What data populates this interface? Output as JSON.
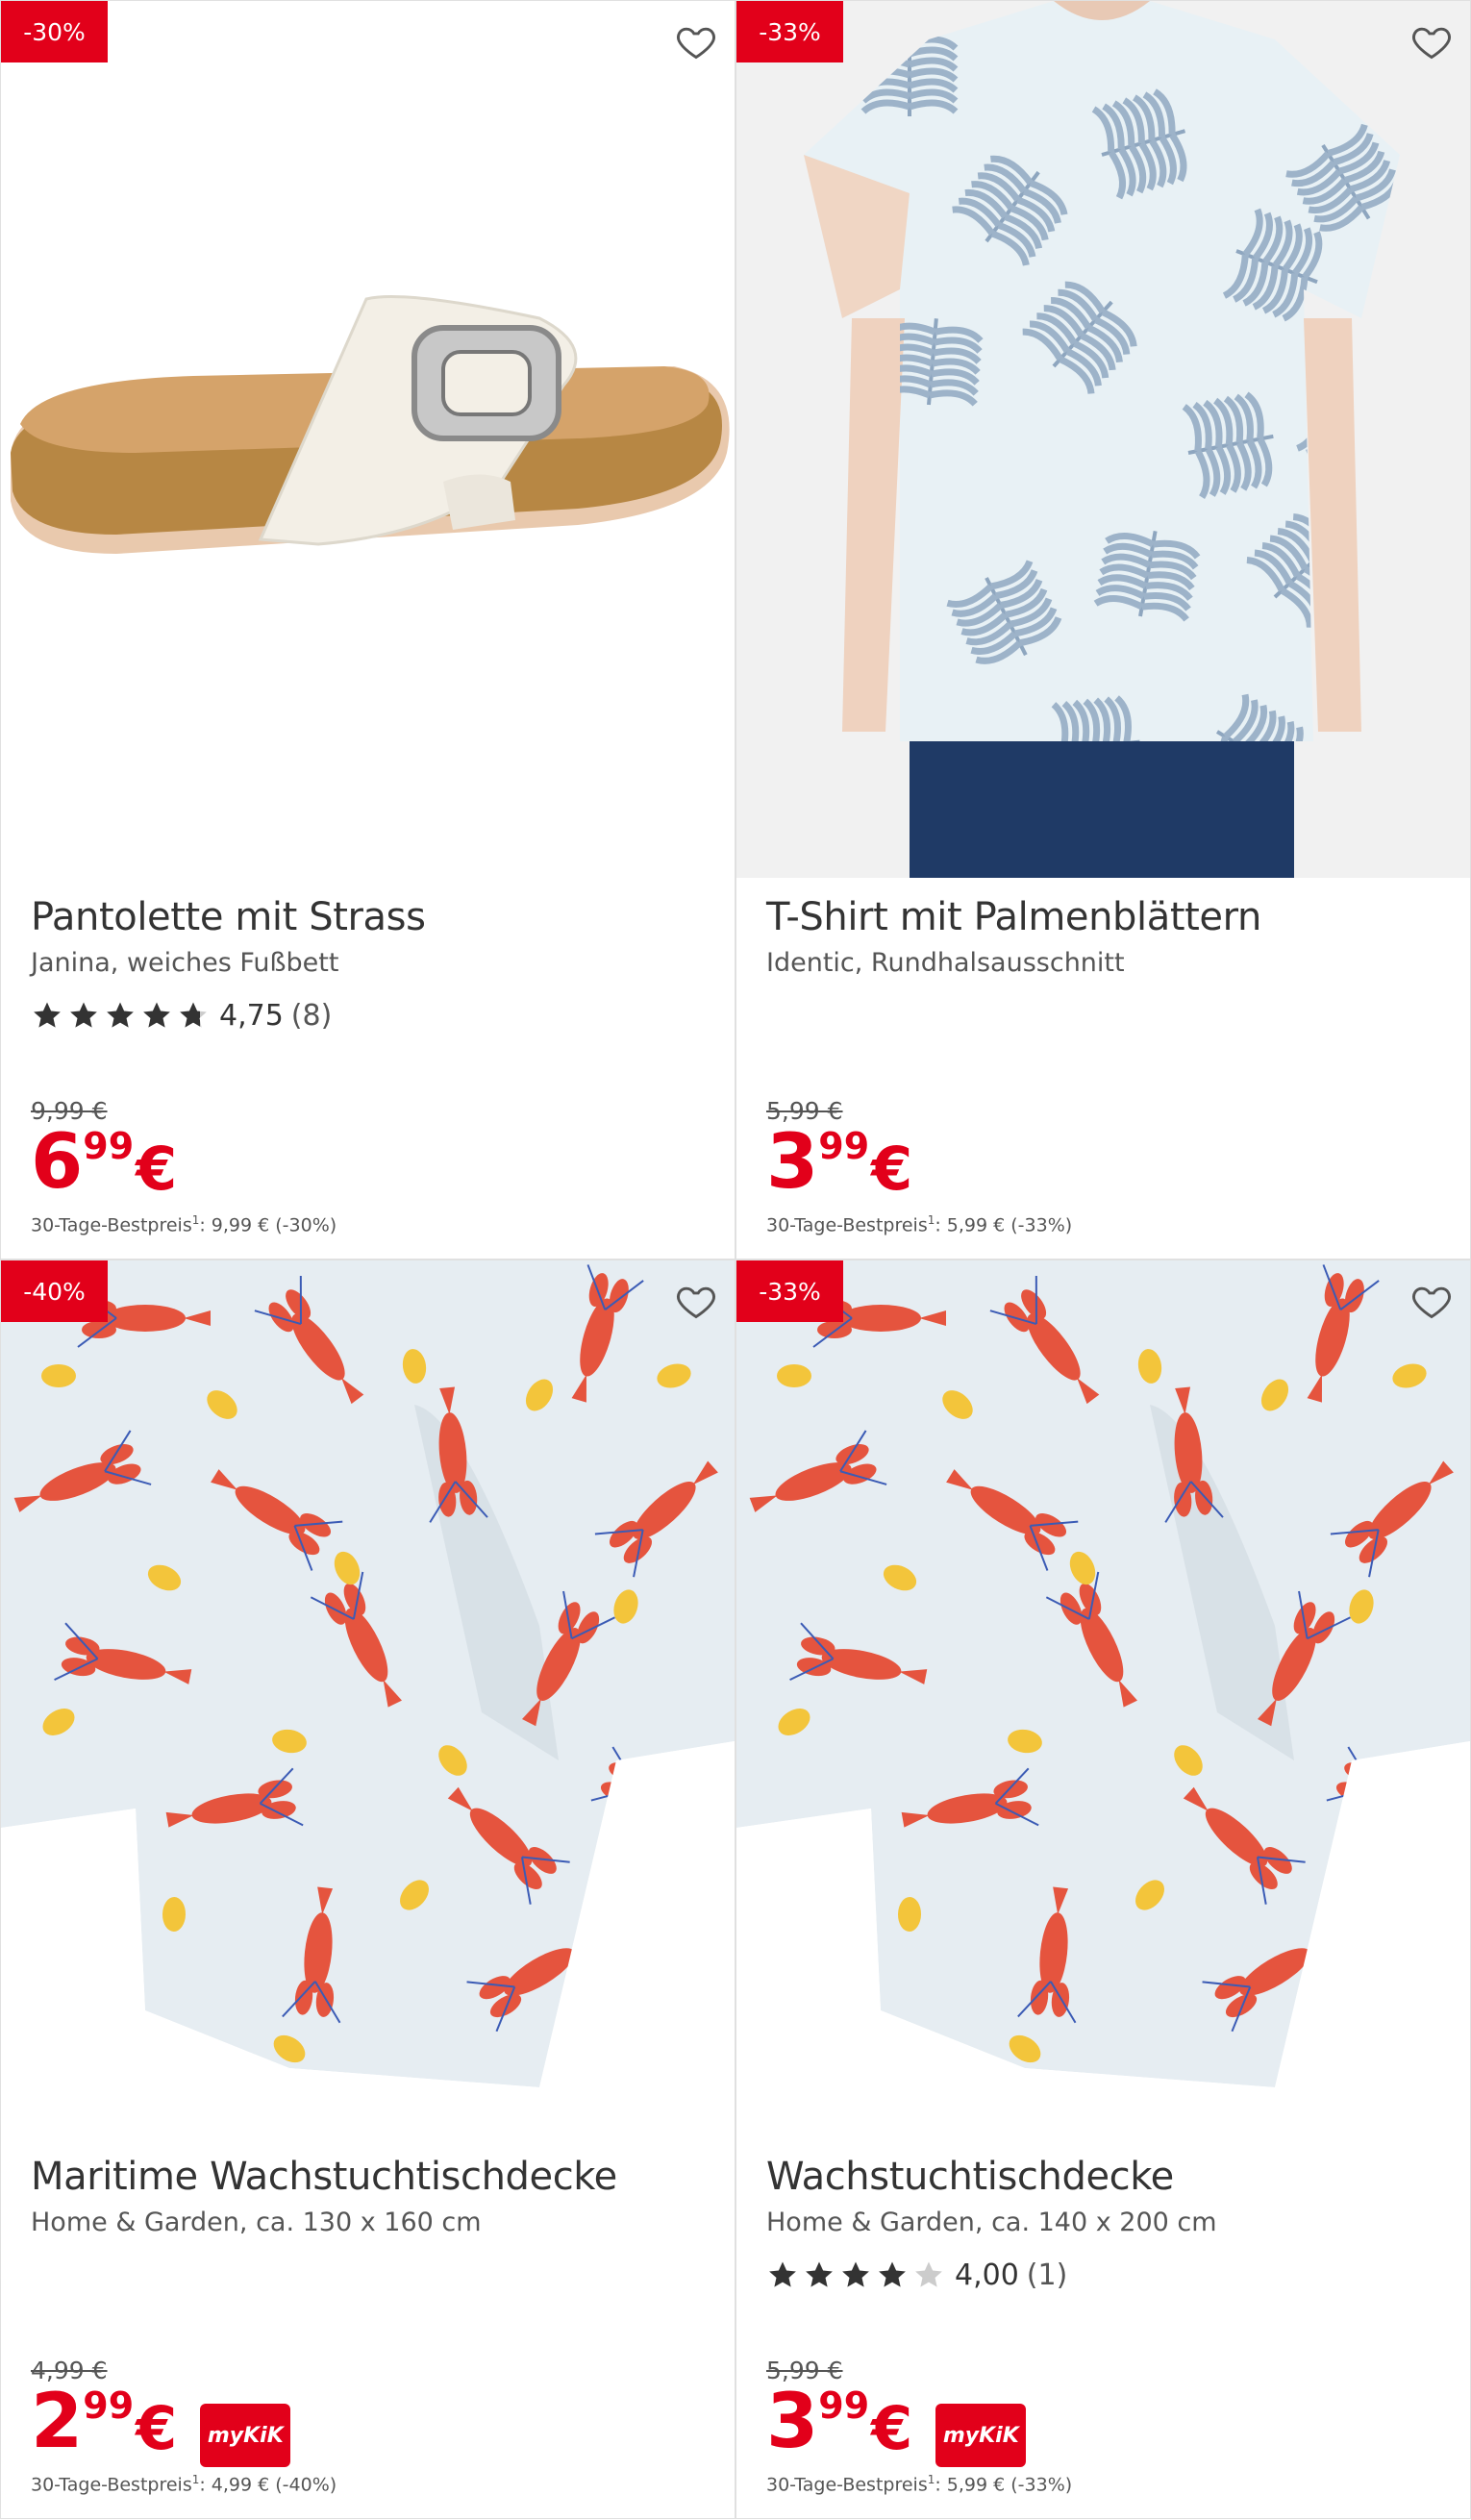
{
  "colors": {
    "accent": "#e2001a",
    "star_filled": "#333333",
    "star_empty": "#cccccc"
  },
  "products": [
    {
      "discount": "-30%",
      "title": "Pantolette mit Strass",
      "subtitle": "Janina, weiches Fußbett",
      "rating": {
        "stars": 4.75,
        "value": "4,75",
        "count": "(8)"
      },
      "old_price": "9,99 €",
      "price_int": "6",
      "price_dec": "99",
      "currency": "€",
      "mykik": "",
      "best_price_label": "30-Tage-Bestpreis",
      "best_price_sup": "1",
      "best_price_value": ": 9,99 € (-30%)",
      "image": "sandal"
    },
    {
      "discount": "-33%",
      "title": "T-Shirt mit Palmenblättern",
      "subtitle": "Identic, Rundhalsausschnitt",
      "rating": null,
      "old_price": "5,99 €",
      "price_int": "3",
      "price_dec": "99",
      "currency": "€",
      "mykik": "",
      "best_price_label": "30-Tage-Bestpreis",
      "best_price_sup": "1",
      "best_price_value": ": 5,99 € (-33%)",
      "image": "tshirt"
    },
    {
      "discount": "-40%",
      "title": "Maritime Wachstuchtischdecke",
      "subtitle": "Home & Garden, ca. 130 x 160 cm",
      "rating": null,
      "old_price": "4,99 €",
      "price_int": "2",
      "price_dec": "99",
      "currency": "€",
      "mykik": "myKiK",
      "best_price_label": "30-Tage-Bestpreis",
      "best_price_sup": "1",
      "best_price_value": ": 4,99 € (-40%)",
      "image": "tablecloth"
    },
    {
      "discount": "-33%",
      "title": "Wachstuchtischdecke",
      "subtitle": "Home & Garden, ca. 140 x 200 cm",
      "rating": {
        "stars": 4,
        "value": "4,00",
        "count": "(1)"
      },
      "old_price": "5,99 €",
      "price_int": "3",
      "price_dec": "99",
      "currency": "€",
      "mykik": "myKiK",
      "best_price_label": "30-Tage-Bestpreis",
      "best_price_sup": "1",
      "best_price_value": ": 5,99 € (-33%)",
      "image": "tablecloth"
    }
  ]
}
